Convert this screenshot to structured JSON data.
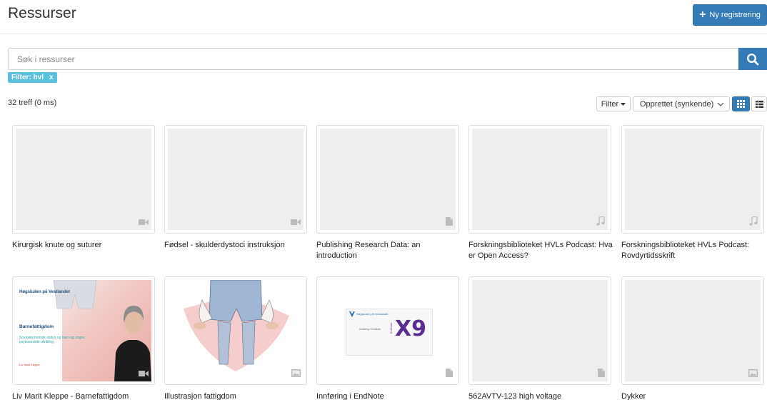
{
  "header": {
    "title": "Ressurser",
    "new_button_label": "Ny registrering"
  },
  "search": {
    "placeholder": "Søk i ressurser",
    "value": ""
  },
  "active_filter": {
    "label": "Filter: hvl",
    "remove": "x"
  },
  "results": {
    "summary": "32 treff (0 ms)"
  },
  "toolbar": {
    "filter_label": "Filter",
    "sort_label": "Opprettet (synkende)"
  },
  "colors": {
    "primary": "#337ab7",
    "filter_tag": "#5bc0de",
    "placeholder": "#eeeeee",
    "icon_gray": "#bbbbbb"
  },
  "items": [
    {
      "title": "Kirurgisk knute og suturer",
      "type_icon": "video-icon"
    },
    {
      "title": "Fødsel - skulderdystoci instruksjon",
      "type_icon": "video-icon"
    },
    {
      "title": "Publishing Research Data: an introduction",
      "type_icon": "document-icon"
    },
    {
      "title": "Forskningsbiblioteket HVLs Podcast: Hva er Open Access?",
      "type_icon": "music-icon"
    },
    {
      "title": "Forskningsbiblioteket HVLs Podcast: Rovdyrtidsskrift",
      "type_icon": "music-icon"
    },
    {
      "title": "Liv Marit Kleppe - Barnefattigdom",
      "type_icon": "video-icon",
      "slide": {
        "logo": "Høgskulen på Vestlandet",
        "heading": "Barnefattigdom",
        "subtitle": "Sosioøkonomisk status og barn og unges psykososiale utvikling",
        "author": "Liv Marit Kleppe"
      }
    },
    {
      "title": "Illustrasjon fattigdom",
      "type_icon": "image-icon"
    },
    {
      "title": "Innføring i EndNote",
      "type_icon": "document-icon",
      "endnote": {
        "logo": "Høgskulen på Vestlandet",
        "product": "X9",
        "brand": "EndNote",
        "subtitle": "Innføring i EndNote"
      }
    },
    {
      "title": "562AVTV-123 high voltage",
      "type_icon": "document-icon"
    },
    {
      "title": "Dykker",
      "type_icon": "image-icon"
    }
  ]
}
